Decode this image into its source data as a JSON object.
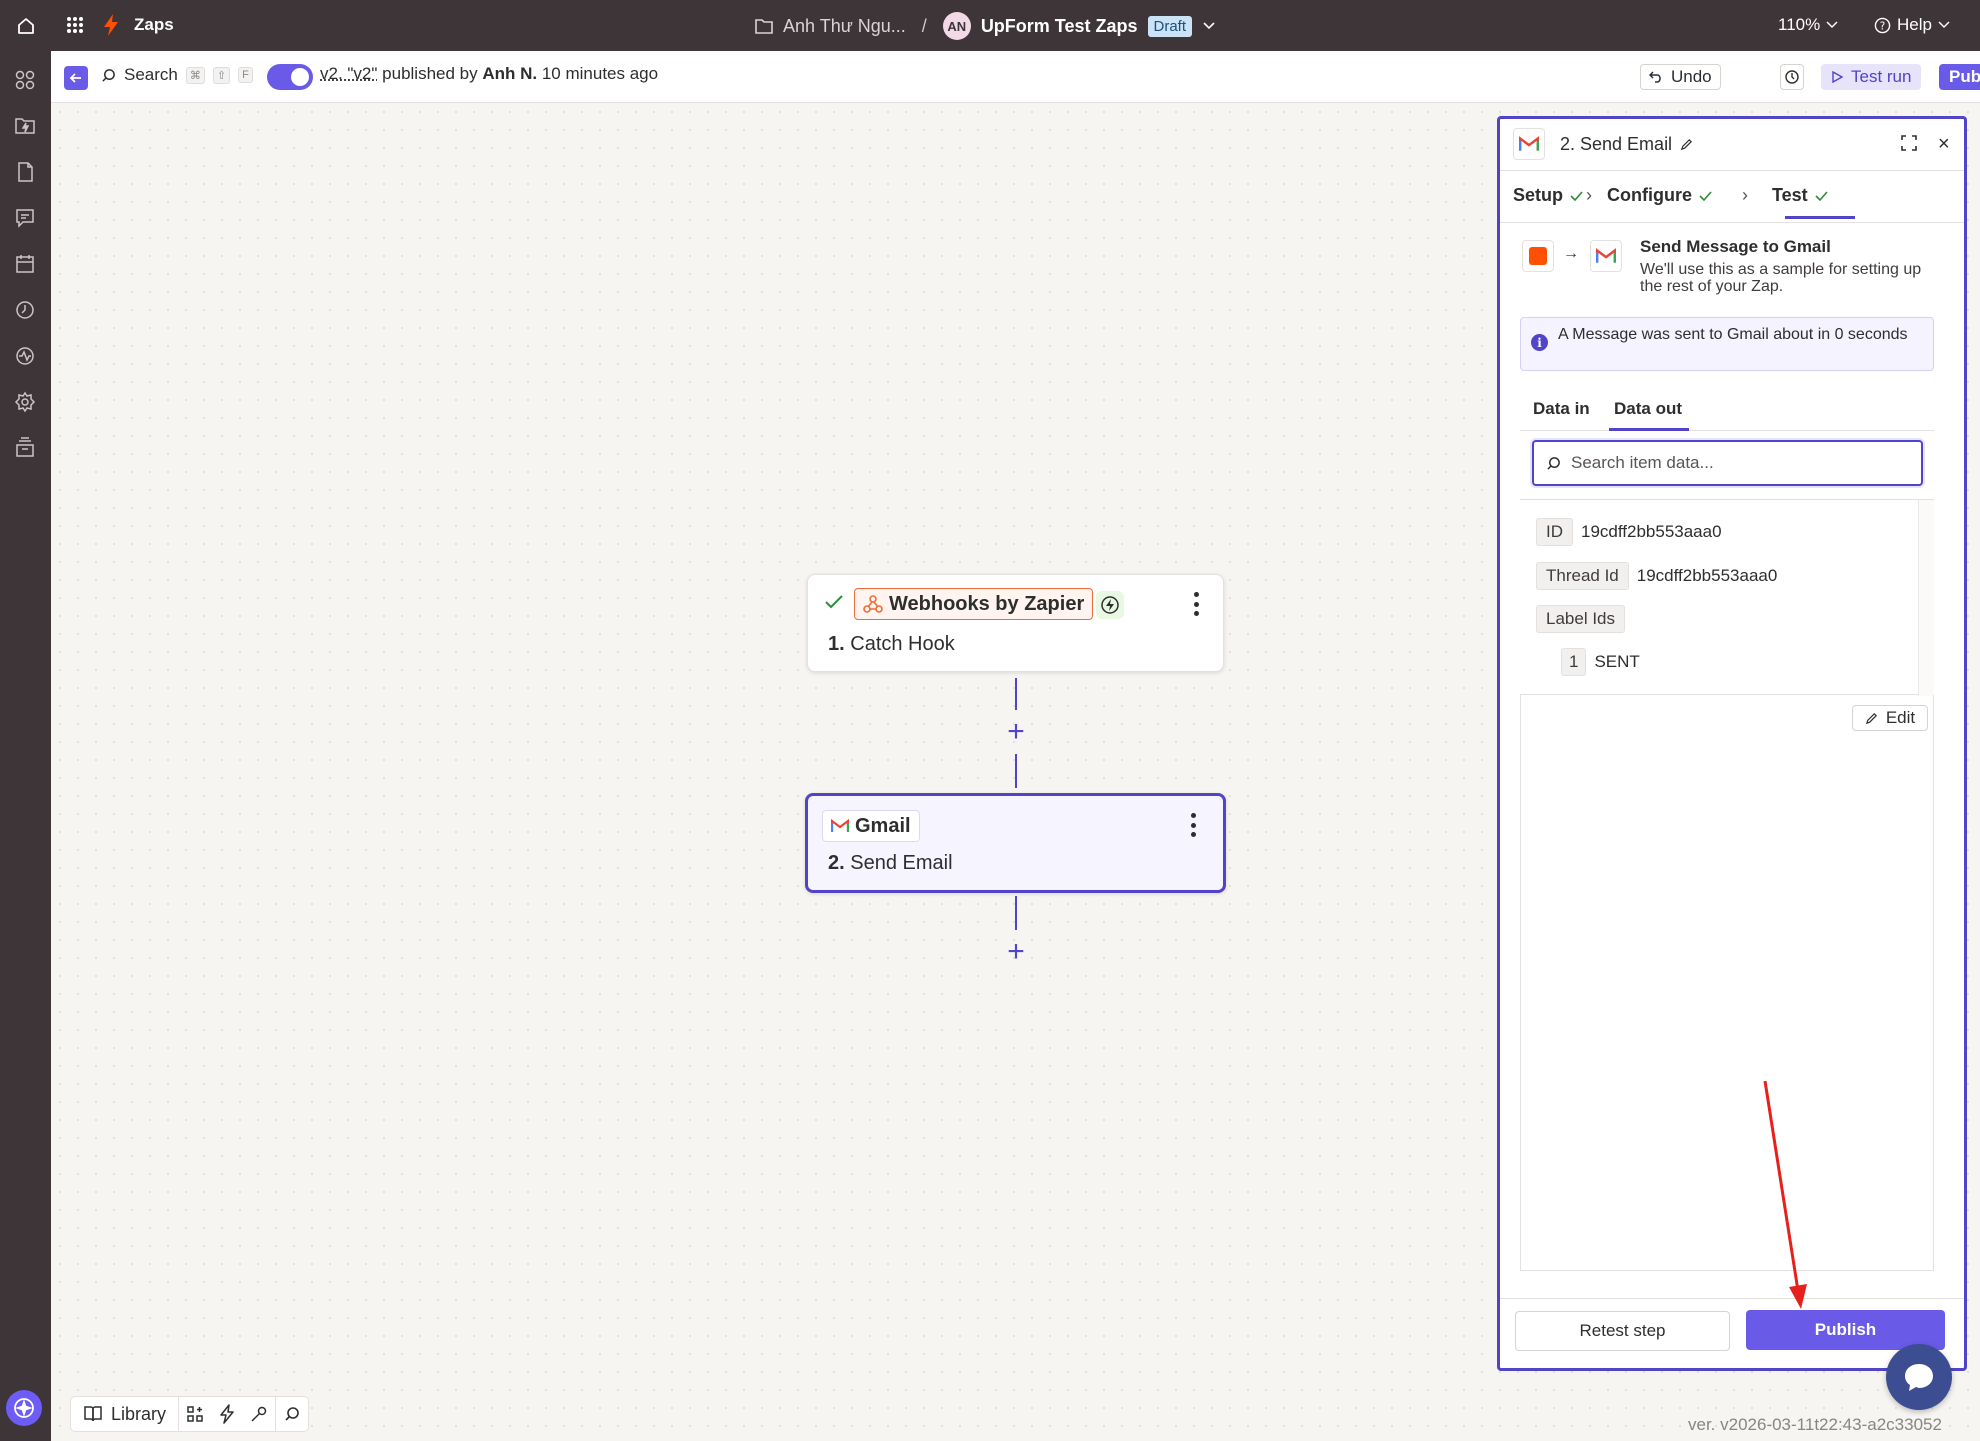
{
  "topbar": {
    "app_name": "Zaps",
    "folder_name": "Anh Thư Ngu...",
    "separator": "/",
    "avatar_initials": "AN",
    "zap_name": "UpForm Test Zaps",
    "status_badge": "Draft",
    "zoom": "110%",
    "help": "Help"
  },
  "subbar": {
    "search_label": "Search",
    "shortcut_keys": [
      "⌘",
      "⇧",
      "F"
    ],
    "version_link": "v2. \"v2\"",
    "published_by_prefix": " published by ",
    "author": "Anh N.",
    "time_ago": " 10 minutes ago",
    "undo_label": "Undo",
    "test_run_label": "Test run",
    "publish_label": "Publish"
  },
  "canvas": {
    "step1": {
      "app": "Webhooks by Zapier",
      "number": "1.",
      "title": "Catch Hook"
    },
    "step2": {
      "app": "Gmail",
      "number": "2.",
      "title": "Send Email"
    }
  },
  "panel": {
    "title": "2. Send Email",
    "steps": [
      "Setup",
      "Configure",
      "Test"
    ],
    "active_step": "Test",
    "message_title": "Send Message to Gmail",
    "message_desc": "We'll use this as a sample for setting up the rest of your Zap.",
    "info_text": "A Message was sent to Gmail about in 0 seconds",
    "data_tabs": [
      "Data in",
      "Data out"
    ],
    "active_data_tab": "Data out",
    "search_placeholder": "Search item data...",
    "data": [
      {
        "key": "ID",
        "value": "19cdff2bb553aaa0"
      },
      {
        "key": "Thread Id",
        "value": "19cdff2bb553aaa0"
      },
      {
        "key": "Label Ids",
        "value": ""
      },
      {
        "key": "1",
        "value": "SENT"
      }
    ],
    "edit_label": "Edit",
    "retest_label": "Retest step",
    "publish_label": "Publish"
  },
  "bottom_toolbar": {
    "library_label": "Library"
  },
  "footer": {
    "version": "ver. v2026-03-11t22:43-a2c33052"
  },
  "colors": {
    "accent": "#695be8",
    "topbar": "#3d3537",
    "zapier_orange": "#ff4f00",
    "annotation_arrow": "#e8201c"
  }
}
